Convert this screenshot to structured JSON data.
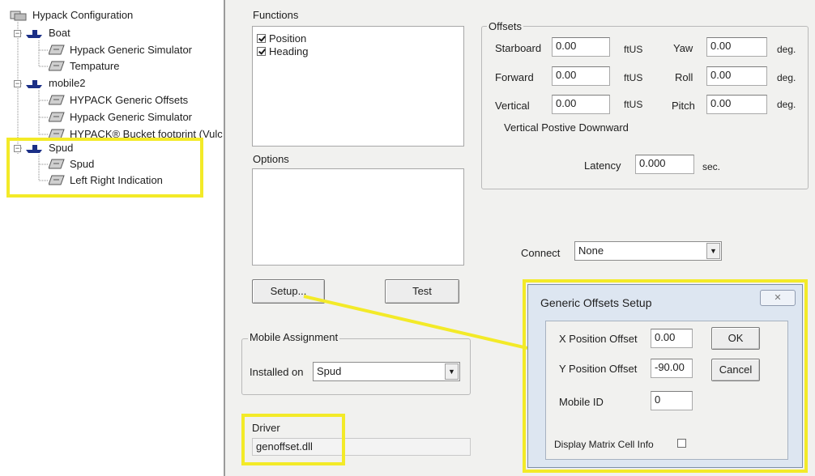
{
  "tree": {
    "root": "Hypack Configuration",
    "boat": {
      "label": "Boat",
      "children": [
        "Hypack Generic Simulator",
        "Tempature"
      ]
    },
    "mobile2": {
      "label": "mobile2",
      "children": [
        "HYPACK Generic Offsets",
        "Hypack Generic Simulator",
        "HYPACK® Bucket footprint (Vulc"
      ]
    },
    "spud": {
      "label": "Spud",
      "children": [
        "Spud",
        "Left Right Indication"
      ]
    },
    "expander_symbol": "−"
  },
  "functions": {
    "title": "Functions",
    "items": [
      {
        "label": "Position",
        "checked": true
      },
      {
        "label": "Heading",
        "checked": true
      }
    ]
  },
  "options": {
    "title": "Options"
  },
  "buttons": {
    "setup": "Setup...",
    "test": "Test"
  },
  "mobile_assignment": {
    "title": "Mobile Assignment",
    "installed_label": "Installed on",
    "installed_value": "Spud"
  },
  "driver": {
    "title": "Driver",
    "value": "genoffset.dll"
  },
  "offsets": {
    "title": "Offsets",
    "starboard": {
      "label": "Starboard",
      "value": "0.00",
      "unit": "ftUS"
    },
    "forward": {
      "label": "Forward",
      "value": "0.00",
      "unit": "ftUS"
    },
    "vertical": {
      "label": "Vertical",
      "value": "0.00",
      "unit": "ftUS"
    },
    "yaw": {
      "label": "Yaw",
      "value": "0.00",
      "unit": "deg."
    },
    "roll": {
      "label": "Roll",
      "value": "0.00",
      "unit": "deg."
    },
    "pitch": {
      "label": "Pitch",
      "value": "0.00",
      "unit": "deg."
    },
    "note": "Vertical Postive Downward",
    "latency": {
      "label": "Latency",
      "value": "0.000",
      "unit": "sec."
    }
  },
  "connect": {
    "label": "Connect",
    "value": "None"
  },
  "dialog": {
    "title": "Generic Offsets Setup",
    "close_symbol": "✕",
    "x_offset": {
      "label": "X Position Offset",
      "value": "0.00"
    },
    "y_offset": {
      "label": "Y Position Offset",
      "value": "-90.00"
    },
    "mobile_id": {
      "label": "Mobile ID",
      "value": "0"
    },
    "display_matrix": {
      "label": "Display Matrix Cell Info",
      "checked": false
    },
    "ok": "OK",
    "cancel": "Cancel"
  },
  "icons": {
    "dropdown": "▼"
  },
  "colors": {
    "highlight": "#f3ea28",
    "boat_icon": "#1b2f86",
    "dialog_frame": "#dde6f1"
  }
}
